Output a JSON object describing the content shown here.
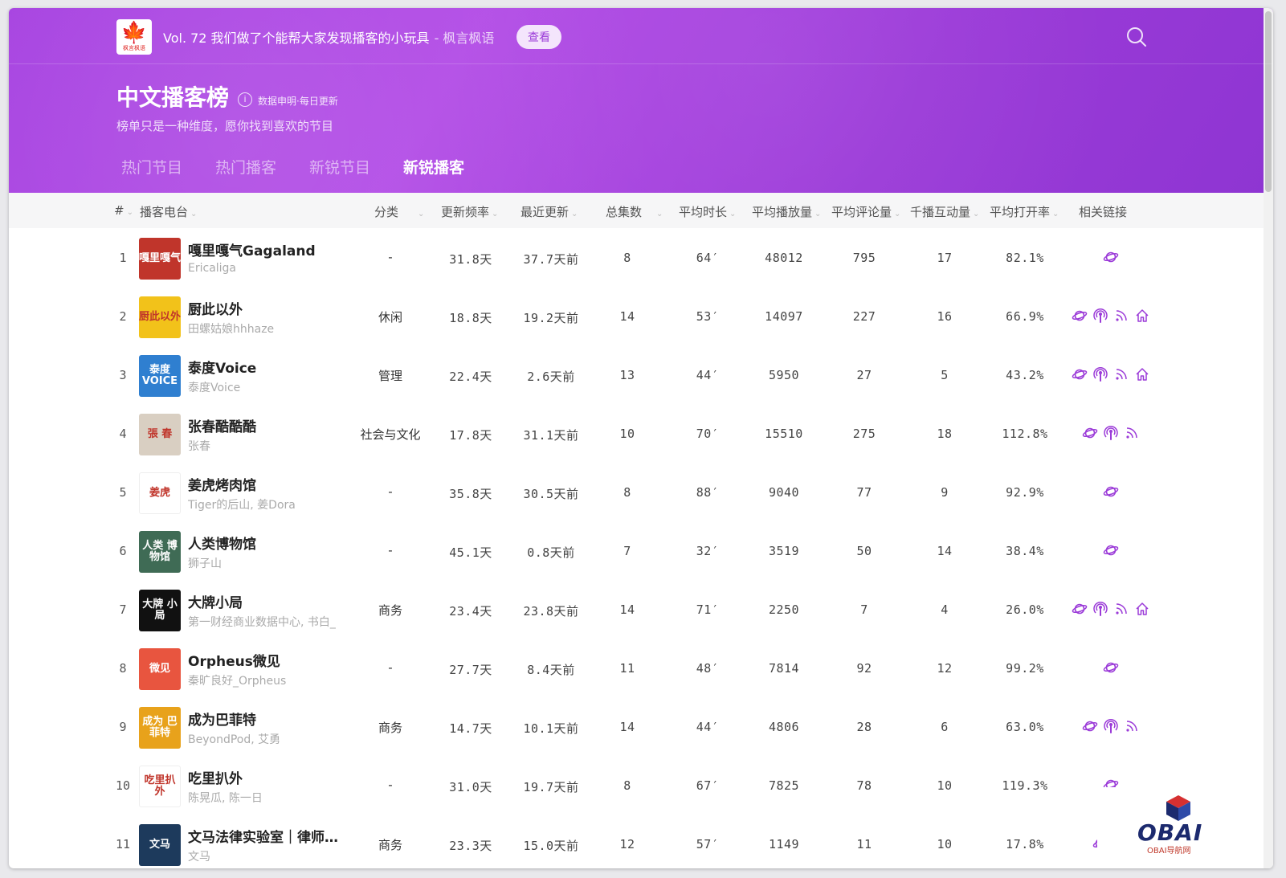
{
  "header": {
    "logo_caption": "枫言枫语",
    "announcement": "Vol. 72 我们做了个能帮大家发现播客的小玩具",
    "announcement_brand": "- 枫言枫语",
    "view_button": "查看",
    "title": "中文播客榜",
    "data_note": "数据申明·每日更新",
    "subtitle": "榜单只是一种维度，愿你找到喜欢的节目"
  },
  "tabs": [
    {
      "label": "热门节目",
      "active": false
    },
    {
      "label": "热门播客",
      "active": false
    },
    {
      "label": "新锐节目",
      "active": false
    },
    {
      "label": "新锐播客",
      "active": true
    }
  ],
  "columns": {
    "rank": "#",
    "podcast": "播客电台",
    "category": "分类",
    "frequency": "更新频率",
    "recent": "最近更新",
    "total": "总集数",
    "duration": "平均时长",
    "plays": "平均播放量",
    "comments": "平均评论量",
    "interaction": "千播互动量",
    "open_rate": "平均打开率",
    "links": "相关链接"
  },
  "colors": {
    "accent": "#9b3bd8",
    "link_icon": "#9b3bd8"
  },
  "rows": [
    {
      "rank": "1",
      "name": "嘎里嘎气Gagaland",
      "author": "Ericaliga",
      "category": "-",
      "frequency": "31.8天",
      "recent": "37.7天前",
      "total": "8",
      "duration": "64′",
      "plays": "48012",
      "comments": "795",
      "interaction": "17",
      "open_rate": "82.1%",
      "links": [
        "planet-icon"
      ],
      "cover_text": "嘎里嘎气",
      "cover_color": "#c0352b"
    },
    {
      "rank": "2",
      "name": "厨此以外",
      "author": "田螺姑娘hhhaze",
      "category": "休闲",
      "frequency": "18.8天",
      "recent": "19.2天前",
      "total": "14",
      "duration": "53′",
      "plays": "14097",
      "comments": "227",
      "interaction": "16",
      "open_rate": "66.9%",
      "links": [
        "planet-icon",
        "podcast-icon",
        "rss-icon",
        "home-icon"
      ],
      "cover_text": "厨此以外",
      "cover_color": "#f2c21a"
    },
    {
      "rank": "3",
      "name": "泰度Voice",
      "author": "泰度Voice",
      "category": "管理",
      "frequency": "22.4天",
      "recent": "2.6天前",
      "total": "13",
      "duration": "44′",
      "plays": "5950",
      "comments": "27",
      "interaction": "5",
      "open_rate": "43.2%",
      "links": [
        "planet-icon",
        "podcast-icon",
        "rss-icon",
        "home-icon"
      ],
      "cover_text": "泰度 VOICE",
      "cover_color": "#2f7fd0"
    },
    {
      "rank": "4",
      "name": "张春酷酷酷",
      "author": "张春",
      "category": "社会与文化",
      "frequency": "17.8天",
      "recent": "31.1天前",
      "total": "10",
      "duration": "70′",
      "plays": "15510",
      "comments": "275",
      "interaction": "18",
      "open_rate": "112.8%",
      "links": [
        "planet-icon",
        "podcast-icon",
        "rss-icon"
      ],
      "cover_text": "張 春",
      "cover_color": "#d9cfc2"
    },
    {
      "rank": "5",
      "name": "姜虎烤肉馆",
      "author": "Tiger的后山, 姜Dora",
      "category": "-",
      "frequency": "35.8天",
      "recent": "30.5天前",
      "total": "8",
      "duration": "88′",
      "plays": "9040",
      "comments": "77",
      "interaction": "9",
      "open_rate": "92.9%",
      "links": [
        "planet-icon"
      ],
      "cover_text": "姜虎",
      "cover_color": "#ffffff"
    },
    {
      "rank": "6",
      "name": "人类博物馆",
      "author": "狮子山",
      "category": "-",
      "frequency": "45.1天",
      "recent": "0.8天前",
      "total": "7",
      "duration": "32′",
      "plays": "3519",
      "comments": "50",
      "interaction": "14",
      "open_rate": "38.4%",
      "links": [
        "planet-icon"
      ],
      "cover_text": "人类 博物馆",
      "cover_color": "#3f6b55"
    },
    {
      "rank": "7",
      "name": "大牌小局",
      "author": "第一财经商业数据中心, 书白_",
      "category": "商务",
      "frequency": "23.4天",
      "recent": "23.8天前",
      "total": "14",
      "duration": "71′",
      "plays": "2250",
      "comments": "7",
      "interaction": "4",
      "open_rate": "26.0%",
      "links": [
        "planet-icon",
        "podcast-icon",
        "rss-icon",
        "home-icon"
      ],
      "cover_text": "大牌 小局",
      "cover_color": "#111111"
    },
    {
      "rank": "8",
      "name": "Orpheus微见",
      "author": "秦旷良好_Orpheus",
      "category": "-",
      "frequency": "27.7天",
      "recent": "8.4天前",
      "total": "11",
      "duration": "48′",
      "plays": "7814",
      "comments": "92",
      "interaction": "12",
      "open_rate": "99.2%",
      "links": [
        "planet-icon"
      ],
      "cover_text": "微见",
      "cover_color": "#e8553f"
    },
    {
      "rank": "9",
      "name": "成为巴菲特",
      "author": "BeyondPod, 艾勇",
      "category": "商务",
      "frequency": "14.7天",
      "recent": "10.1天前",
      "total": "14",
      "duration": "44′",
      "plays": "4806",
      "comments": "28",
      "interaction": "6",
      "open_rate": "63.0%",
      "links": [
        "planet-icon",
        "podcast-icon",
        "rss-icon"
      ],
      "cover_text": "成为 巴菲特",
      "cover_color": "#e8a21b"
    },
    {
      "rank": "10",
      "name": "吃里扒外",
      "author": "陈晃瓜, 陈一日",
      "category": "-",
      "frequency": "31.0天",
      "recent": "19.7天前",
      "total": "8",
      "duration": "67′",
      "plays": "7825",
      "comments": "78",
      "interaction": "10",
      "open_rate": "119.3%",
      "links": [
        "planet-icon"
      ],
      "cover_text": "吃里扒外",
      "cover_color": "#ffffff"
    },
    {
      "rank": "11",
      "name": "文马法律实验室｜律师…",
      "author": "文马",
      "category": "商务",
      "frequency": "23.3天",
      "recent": "15.0天前",
      "total": "12",
      "duration": "57′",
      "plays": "1149",
      "comments": "11",
      "interaction": "10",
      "open_rate": "17.8%",
      "links": [
        "planet-icon",
        "podcast-icon"
      ],
      "cover_text": "文马",
      "cover_color": "#1d3a5c"
    }
  ],
  "watermark": {
    "text": "OBAI",
    "sub": "OBAI导航网"
  }
}
